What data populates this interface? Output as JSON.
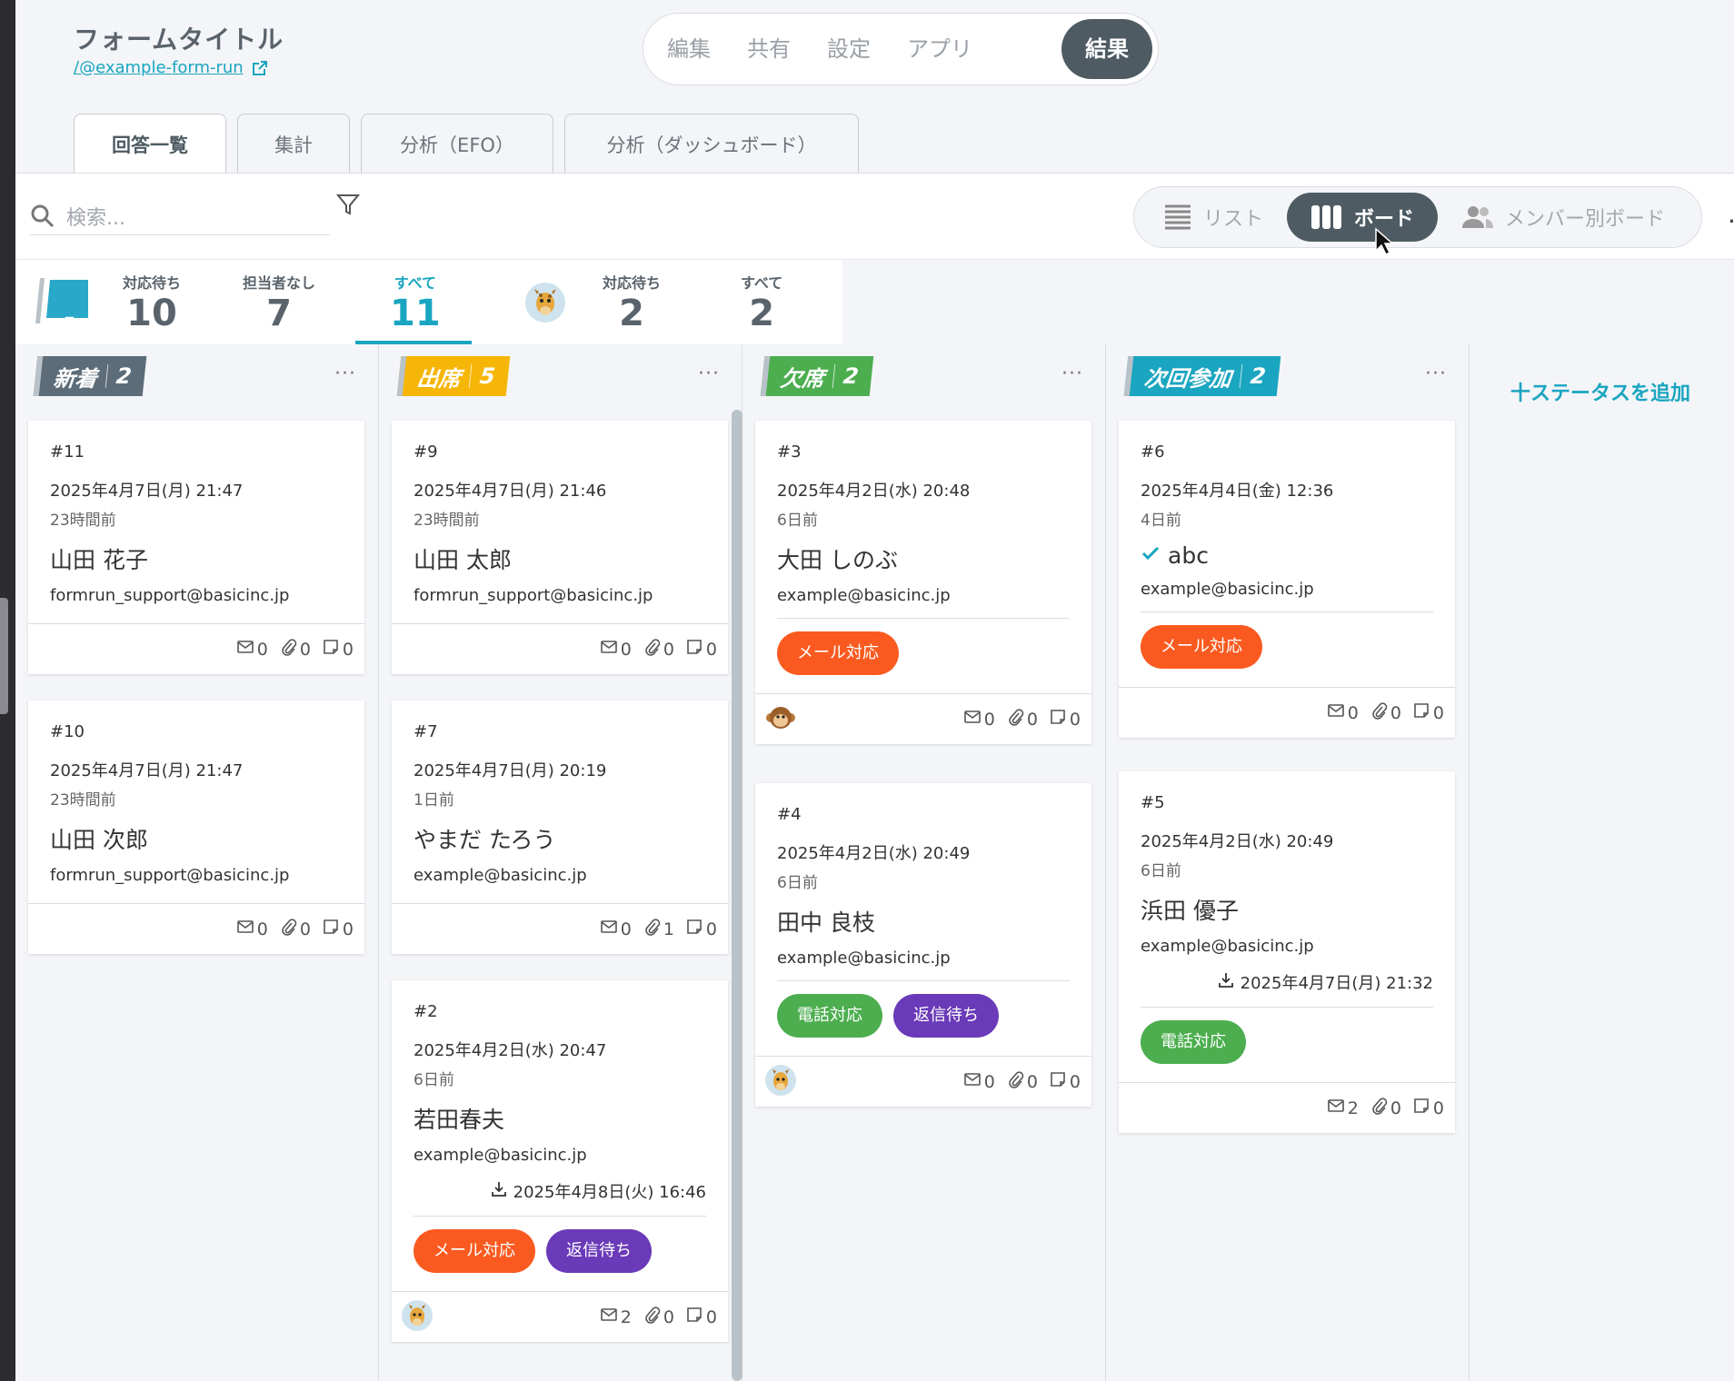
{
  "header": {
    "form_title": "フォームタイトル",
    "form_link": "/@example-form-run",
    "modes": [
      "編集",
      "共有",
      "設定",
      "アプリ"
    ],
    "active_mode": "結果"
  },
  "tabs": [
    "回答一覧",
    "集計",
    "分析（EFO）",
    "分析（ダッシュボード）"
  ],
  "toolbar": {
    "search_placeholder": "検索...",
    "views": [
      "リスト",
      "ボード",
      "メンバー別ボード"
    ],
    "more": "···"
  },
  "stats": {
    "tag_label": "_",
    "group1": [
      {
        "label": "対応待ち",
        "value": "10"
      },
      {
        "label": "担当者なし",
        "value": "7"
      },
      {
        "label": "すべて",
        "value": "11"
      }
    ],
    "group2": [
      {
        "label": "対応待ち",
        "value": "2"
      },
      {
        "label": "すべて",
        "value": "2"
      }
    ]
  },
  "columns": [
    {
      "name": "新着",
      "count": "2",
      "color": "#5c6c78",
      "cards": [
        {
          "num": "#11",
          "date": "2025年4月7日(月) 21:47",
          "rel": "23時間前",
          "name": "山田 花子",
          "email": "formrun_support@basicinc.jp",
          "mail": "0",
          "attach": "0",
          "memo": "0"
        },
        {
          "num": "#10",
          "date": "2025年4月7日(月) 21:47",
          "rel": "23時間前",
          "name": "山田 次郎",
          "email": "formrun_support@basicinc.jp",
          "mail": "0",
          "attach": "0",
          "memo": "0"
        }
      ]
    },
    {
      "name": "出席",
      "count": "5",
      "color": "#f6b608",
      "cards": [
        {
          "num": "#9",
          "date": "2025年4月7日(月) 21:46",
          "rel": "23時間前",
          "name": "山田 太郎",
          "email": "formrun_support@basicinc.jp",
          "mail": "0",
          "attach": "0",
          "memo": "0"
        },
        {
          "num": "#7",
          "date": "2025年4月7日(月) 20:19",
          "rel": "1日前",
          "name": "やまだ たろう",
          "email": "example@basicinc.jp",
          "mail": "0",
          "attach": "1",
          "memo": "0"
        },
        {
          "num": "#2",
          "date": "2025年4月2日(水) 20:47",
          "rel": "6日前",
          "name": "若田春夫",
          "email": "example@basicinc.jp",
          "extra": "2025年4月8日(火) 16:46",
          "tags": [
            "メール対応",
            "返信待ち"
          ],
          "mail": "2",
          "attach": "0",
          "memo": "0"
        }
      ]
    },
    {
      "name": "欠席",
      "count": "2",
      "color": "#4cae4f",
      "cards": [
        {
          "num": "#3",
          "date": "2025年4月2日(水) 20:48",
          "rel": "6日前",
          "name": "大田 しのぶ",
          "email": "example@basicinc.jp",
          "tags": [
            "メール対応"
          ],
          "mail": "0",
          "attach": "0",
          "memo": "0"
        },
        {
          "num": "#4",
          "date": "2025年4月2日(水) 20:49",
          "rel": "6日前",
          "name": "田中 良枝",
          "email": "example@basicinc.jp",
          "tags": [
            "電話対応",
            "返信待ち"
          ],
          "mail": "0",
          "attach": "0",
          "memo": "0"
        }
      ]
    },
    {
      "name": "次回参加",
      "count": "2",
      "color": "#1aa5c0",
      "cards": [
        {
          "num": "#6",
          "date": "2025年4月4日(金) 12:36",
          "rel": "4日前",
          "name": "abc",
          "email": "example@basicinc.jp",
          "tags": [
            "メール対応"
          ],
          "mail": "0",
          "attach": "0",
          "memo": "0"
        },
        {
          "num": "#5",
          "date": "2025年4月2日(水) 20:49",
          "rel": "6日前",
          "name": "浜田 優子",
          "email": "example@basicinc.jp",
          "extra": "2025年4月7日(月) 21:32",
          "tags": [
            "電話対応"
          ],
          "mail": "2",
          "attach": "0",
          "memo": "0"
        }
      ]
    }
  ],
  "add_status": "十ステータスを追加",
  "colors": {
    "accent": "#1aa5c0",
    "dark": "#4e5b63",
    "mail_tag": "#fa5a20",
    "phone_tag": "#4cae4f",
    "wait_tag": "#6a3ab8"
  }
}
